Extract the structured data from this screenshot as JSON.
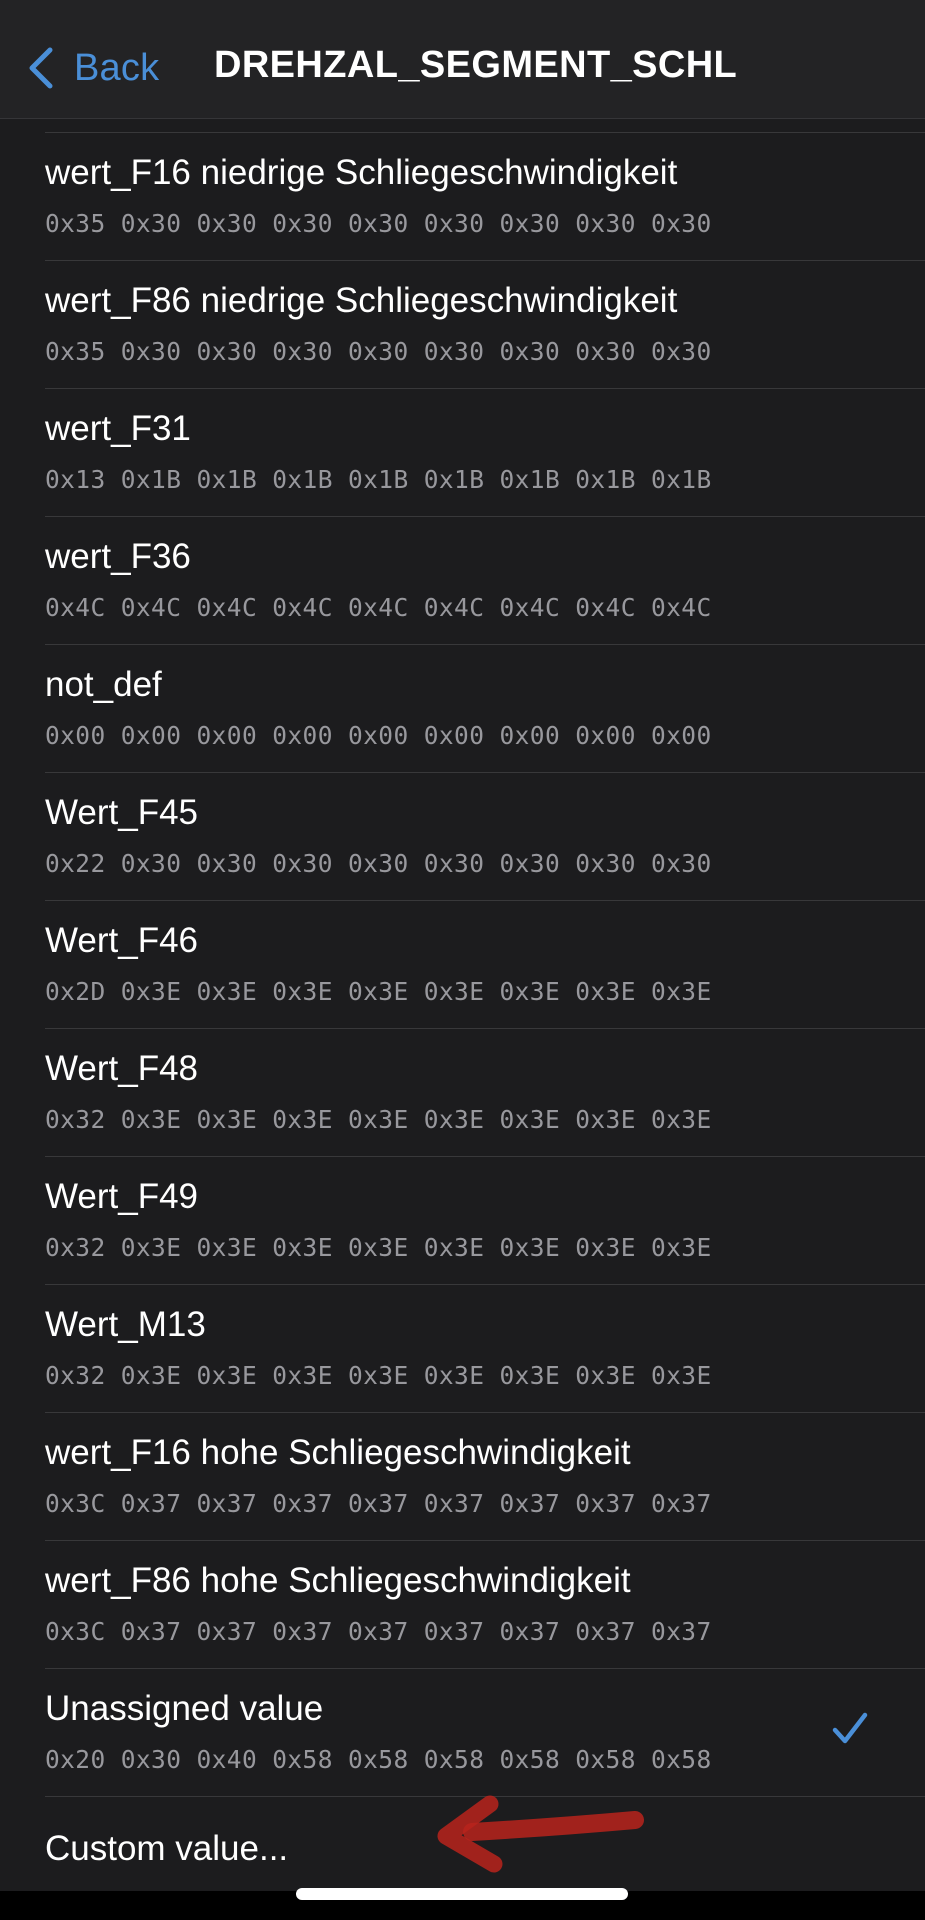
{
  "navbar": {
    "back_label": "Back",
    "title": "DREHZAL_SEGMENT_SCHL"
  },
  "items": [
    {
      "label": "wert_F16 niedrige Schliegeschwindigkeit",
      "bytes": "0x35 0x30 0x30 0x30 0x30 0x30 0x30 0x30 0x30",
      "selected": false
    },
    {
      "label": "wert_F86 niedrige Schliegeschwindigkeit",
      "bytes": "0x35 0x30 0x30 0x30 0x30 0x30 0x30 0x30 0x30",
      "selected": false
    },
    {
      "label": "wert_F31",
      "bytes": "0x13 0x1B 0x1B 0x1B 0x1B 0x1B 0x1B 0x1B 0x1B",
      "selected": false
    },
    {
      "label": "wert_F36",
      "bytes": "0x4C 0x4C 0x4C 0x4C 0x4C 0x4C 0x4C 0x4C 0x4C",
      "selected": false
    },
    {
      "label": "not_def",
      "bytes": "0x00 0x00 0x00 0x00 0x00 0x00 0x00 0x00 0x00",
      "selected": false
    },
    {
      "label": "Wert_F45",
      "bytes": "0x22 0x30 0x30 0x30 0x30 0x30 0x30 0x30 0x30",
      "selected": false
    },
    {
      "label": "Wert_F46",
      "bytes": "0x2D 0x3E 0x3E 0x3E 0x3E 0x3E 0x3E 0x3E 0x3E",
      "selected": false
    },
    {
      "label": "Wert_F48",
      "bytes": "0x32 0x3E 0x3E 0x3E 0x3E 0x3E 0x3E 0x3E 0x3E",
      "selected": false
    },
    {
      "label": "Wert_F49",
      "bytes": "0x32 0x3E 0x3E 0x3E 0x3E 0x3E 0x3E 0x3E 0x3E",
      "selected": false
    },
    {
      "label": "Wert_M13",
      "bytes": "0x32 0x3E 0x3E 0x3E 0x3E 0x3E 0x3E 0x3E 0x3E",
      "selected": false
    },
    {
      "label": "wert_F16 hohe Schliegeschwindigkeit",
      "bytes": "0x3C 0x37 0x37 0x37 0x37 0x37 0x37 0x37 0x37",
      "selected": false
    },
    {
      "label": "wert_F86 hohe Schliegeschwindigkeit",
      "bytes": "0x3C 0x37 0x37 0x37 0x37 0x37 0x37 0x37 0x37",
      "selected": false
    },
    {
      "label": "Unassigned value",
      "bytes": "0x20 0x30 0x40 0x58 0x58 0x58 0x58 0x58 0x58",
      "selected": true
    }
  ],
  "custom": {
    "label": "Custom value..."
  },
  "icons": {
    "back": "chevron-left-icon",
    "selected": "checkmark-icon",
    "annotation": "red-arrow-annotation"
  },
  "colors": {
    "background": "#1c1c1e",
    "navbar": "#232325",
    "accent": "#4a8fd8",
    "secondary_text": "#98989d",
    "separator": "#38383a",
    "annotation": "#b8231c"
  }
}
